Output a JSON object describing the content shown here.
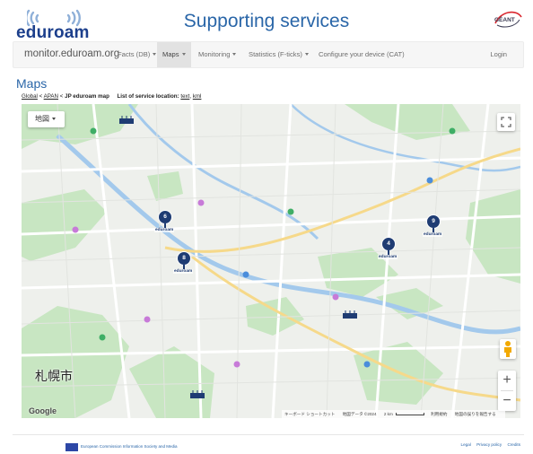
{
  "header": {
    "logo_text": "eduroam",
    "title": "Supporting services",
    "partner_logo_text": "GÉANT"
  },
  "nav": {
    "brand": "monitor.eduroam.org",
    "items": [
      {
        "label": "Facts (DB)",
        "dropdown": true,
        "active": false
      },
      {
        "label": "Maps",
        "dropdown": true,
        "active": true
      },
      {
        "label": "Monitoring",
        "dropdown": true,
        "active": false
      },
      {
        "label": "Statistics (F-ticks)",
        "dropdown": true,
        "active": false
      },
      {
        "label": "Configure your device (CAT)",
        "dropdown": false,
        "active": false
      }
    ],
    "login": "Login"
  },
  "page": {
    "heading": "Maps",
    "breadcrumb": {
      "global": "Global",
      "apan": "APAN",
      "jp": "JP eduroam map",
      "list_label": "List of service location:",
      "text_link": "text",
      "kml_link": "kml"
    }
  },
  "map": {
    "map_type_label": "地図",
    "city_label": "札幌市",
    "google_logo": "Google",
    "attribution": [
      "キーボード ショートカット",
      "地図データ ©2024",
      "2 km",
      "利用規約",
      "地図の誤りを報告する"
    ],
    "clusters": [
      {
        "id": "cluster-6",
        "count": "6",
        "tag": "eduroam"
      },
      {
        "id": "cluster-8",
        "count": "8",
        "tag": "eduroam"
      },
      {
        "id": "cluster-4",
        "count": "4",
        "tag": "eduroam"
      },
      {
        "id": "cluster-9",
        "count": "9",
        "tag": "eduroam"
      }
    ],
    "colors": {
      "water": "#a3c9ec",
      "park": "#c8e6c2",
      "road": "#ffffff",
      "land": "#eef0ec",
      "marker": "#1f3c73"
    }
  },
  "footer": {
    "funding": "European Commission Information Society and Media",
    "links": [
      "Legal",
      "Privacy policy",
      "Credits"
    ]
  }
}
